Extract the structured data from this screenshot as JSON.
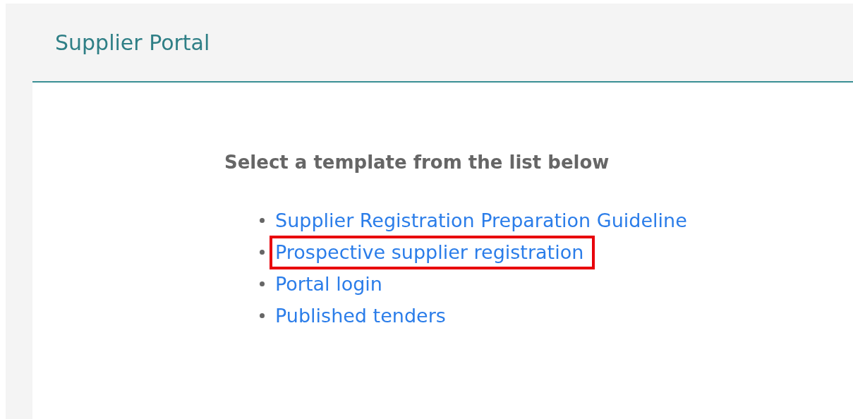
{
  "header": {
    "title": "Supplier Portal"
  },
  "content": {
    "heading": "Select a template from the list below",
    "links": [
      {
        "label": "Supplier Registration Preparation Guideline",
        "highlighted": false
      },
      {
        "label": "Prospective supplier registration",
        "highlighted": true
      },
      {
        "label": "Portal login",
        "highlighted": false
      },
      {
        "label": "Published tenders",
        "highlighted": false
      }
    ]
  }
}
